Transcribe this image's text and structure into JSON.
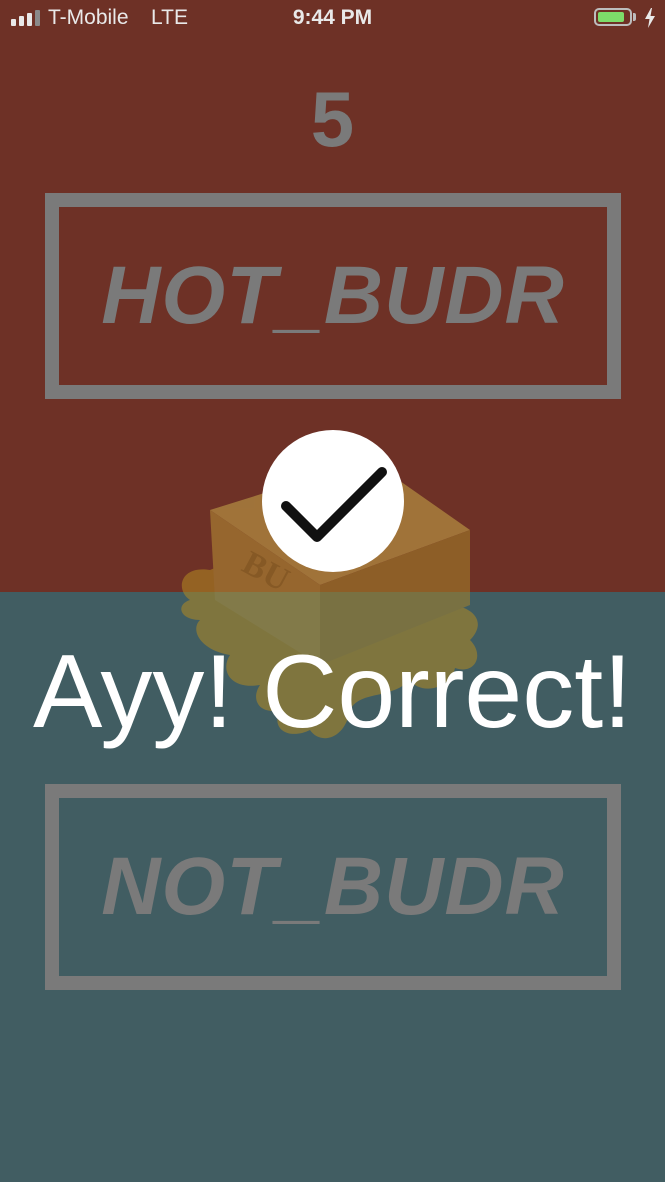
{
  "status_bar": {
    "carrier": "T-Mobile",
    "network": "LTE",
    "time": "9:44 PM",
    "signal_bars_filled": 3,
    "signal_bars_total": 4,
    "battery_level": 0.85,
    "charging": true,
    "battery_color": "#7ddc6a",
    "signal_color": "#e9e9e9",
    "signal_dim_color": "#8a8a8a"
  },
  "game": {
    "score": "5",
    "hot_option_label": "HOT_BUDR",
    "not_option_label": "NOT_BUDR",
    "result_message": "Ayy! Correct!",
    "result_icon": "check-icon",
    "image_subject": "butter-icon"
  },
  "colors": {
    "hot_background": "#6e3126",
    "not_background": "#415d62",
    "overlay_text": "#7a7a7a",
    "result_text": "#ffffff"
  }
}
